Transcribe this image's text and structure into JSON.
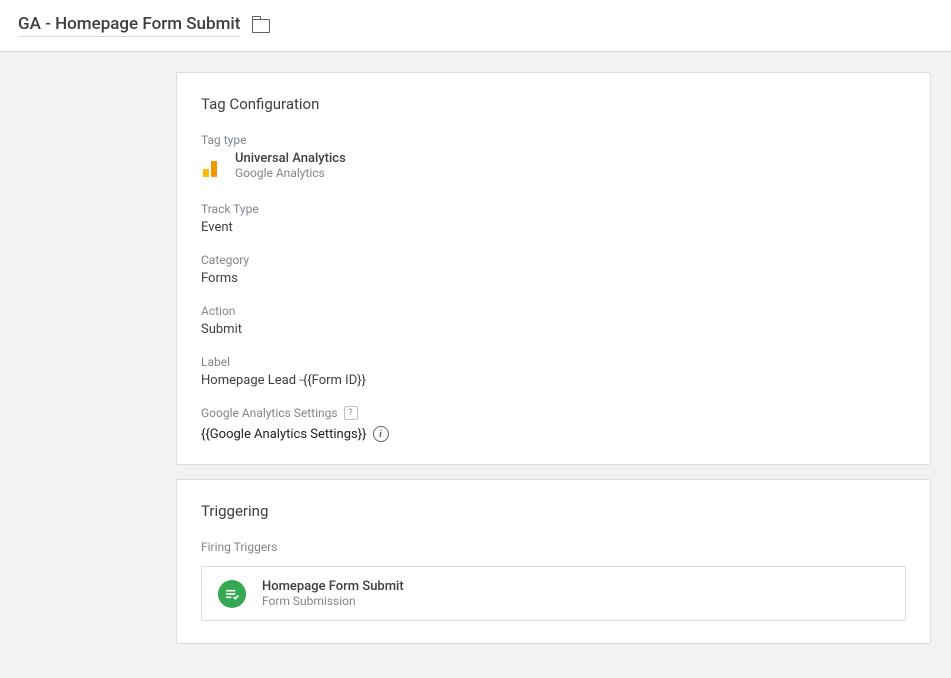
{
  "header": {
    "title": "GA - Homepage Form Submit"
  },
  "tagConfig": {
    "cardTitle": "Tag Configuration",
    "tagTypeLabel": "Tag type",
    "tagTypeName": "Universal Analytics",
    "tagTypeSub": "Google Analytics",
    "trackTypeLabel": "Track Type",
    "trackTypeValue": "Event",
    "categoryLabel": "Category",
    "categoryValue": "Forms",
    "actionLabel": "Action",
    "actionValue": "Submit",
    "labelLabel": "Label",
    "labelValue": "Homepage Lead -{{Form ID}}",
    "gaSettingsLabel": "Google Analytics Settings",
    "gaSettingsValue": "{{Google Analytics Settings}}"
  },
  "triggering": {
    "cardTitle": "Triggering",
    "firingLabel": "Firing Triggers",
    "triggerName": "Homepage Form Submit",
    "triggerType": "Form Submission"
  }
}
